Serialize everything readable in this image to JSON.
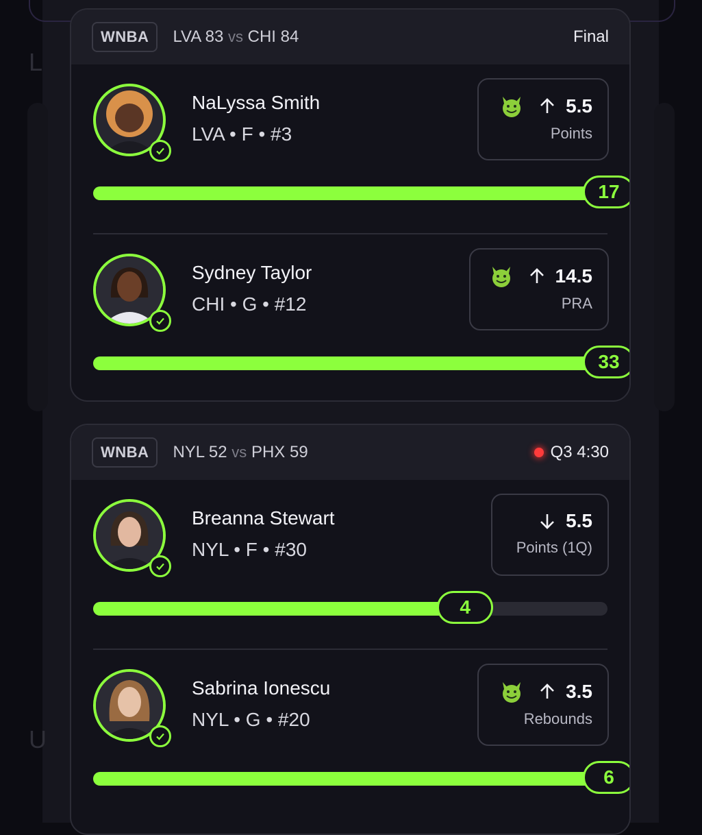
{
  "colors": {
    "accent": "#8cff3d",
    "live": "#ff3b3b",
    "card_bg": "#12121a",
    "header_bg": "#1d1d26"
  },
  "games": [
    {
      "league": "WNBA",
      "away_team": "LVA",
      "away_score": "83",
      "vs": "vs",
      "home_team": "CHI",
      "home_score": "84",
      "status": "Final",
      "live": false,
      "players": [
        {
          "name": "NaLyssa Smith",
          "meta": "LVA • F • #3",
          "icon": "devil-emoji-icon",
          "direction": "up",
          "line": "5.5",
          "stat": "Points",
          "current": "17",
          "progress": 1.0
        },
        {
          "name": "Sydney Taylor",
          "meta": "CHI • G • #12",
          "icon": "devil-emoji-icon",
          "direction": "up",
          "line": "14.5",
          "stat": "PRA",
          "current": "33",
          "progress": 1.0
        }
      ]
    },
    {
      "league": "WNBA",
      "away_team": "NYL",
      "away_score": "52",
      "vs": "vs",
      "home_team": "PHX",
      "home_score": "59",
      "status": "Q3 4:30",
      "live": true,
      "players": [
        {
          "name": "Breanna Stewart",
          "meta": "NYL • F • #30",
          "icon": null,
          "direction": "down",
          "line": "5.5",
          "stat": "Points (1Q)",
          "current": "4",
          "progress": 0.73
        },
        {
          "name": "Sabrina Ionescu",
          "meta": "NYL • G • #20",
          "icon": "devil-emoji-icon",
          "direction": "up",
          "line": "3.5",
          "stat": "Rebounds",
          "current": "6",
          "progress": 1.0
        }
      ]
    }
  ]
}
